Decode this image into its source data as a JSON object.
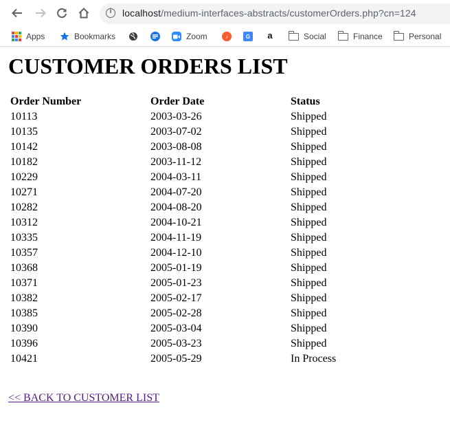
{
  "browser": {
    "url_host": "localhost",
    "url_path": "/medium-interfaces-abstracts/customerOrders.php?cn=124",
    "bookmarks": [
      {
        "label": "Apps",
        "icon": "apps-grid-icon"
      },
      {
        "label": "Bookmarks",
        "icon": "star-icon"
      },
      {
        "label": "",
        "icon": "globe-icon"
      },
      {
        "label": "",
        "icon": "chat-icon"
      },
      {
        "label": "Zoom",
        "icon": "zoom-camera-icon"
      },
      {
        "label": "",
        "icon": "music-icon"
      },
      {
        "label": "",
        "icon": "translate-icon"
      },
      {
        "label": "",
        "icon": "amazon-icon"
      },
      {
        "label": "Social",
        "icon": "folder-icon"
      },
      {
        "label": "Finance",
        "icon": "folder-icon"
      },
      {
        "label": "Personal",
        "icon": "folder-icon"
      }
    ],
    "colors": {
      "accent_blue": "#1a73e8",
      "icon_gray": "#5f6368",
      "link_visited": "#551a8b"
    }
  },
  "page": {
    "title": "CUSTOMER ORDERS LIST",
    "table": {
      "headers": [
        "Order Number",
        "Order Date",
        "Status"
      ],
      "rows": [
        [
          "10113",
          "2003-03-26",
          "Shipped"
        ],
        [
          "10135",
          "2003-07-02",
          "Shipped"
        ],
        [
          "10142",
          "2003-08-08",
          "Shipped"
        ],
        [
          "10182",
          "2003-11-12",
          "Shipped"
        ],
        [
          "10229",
          "2004-03-11",
          "Shipped"
        ],
        [
          "10271",
          "2004-07-20",
          "Shipped"
        ],
        [
          "10282",
          "2004-08-20",
          "Shipped"
        ],
        [
          "10312",
          "2004-10-21",
          "Shipped"
        ],
        [
          "10335",
          "2004-11-19",
          "Shipped"
        ],
        [
          "10357",
          "2004-12-10",
          "Shipped"
        ],
        [
          "10368",
          "2005-01-19",
          "Shipped"
        ],
        [
          "10371",
          "2005-01-23",
          "Shipped"
        ],
        [
          "10382",
          "2005-02-17",
          "Shipped"
        ],
        [
          "10385",
          "2005-02-28",
          "Shipped"
        ],
        [
          "10390",
          "2005-03-04",
          "Shipped"
        ],
        [
          "10396",
          "2005-03-23",
          "Shipped"
        ],
        [
          "10421",
          "2005-05-29",
          "In Process"
        ]
      ]
    },
    "back_link": "<< BACK TO CUSTOMER LIST"
  }
}
